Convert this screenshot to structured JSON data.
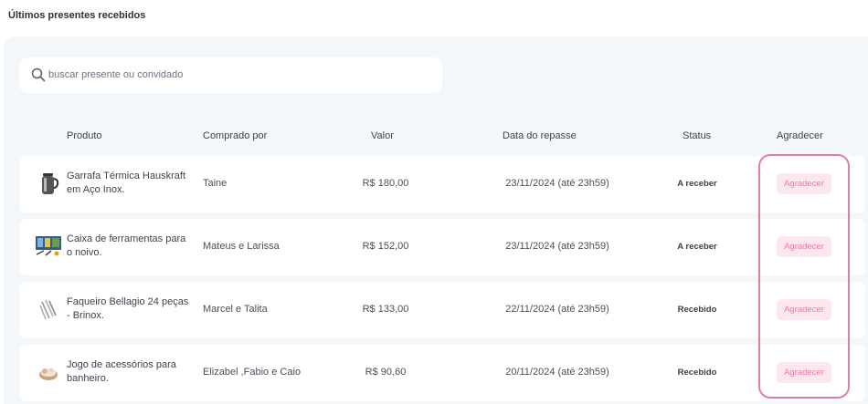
{
  "section": {
    "title": "Últimos presentes recebidos"
  },
  "search": {
    "placeholder": "buscar presente ou convidado",
    "value": ""
  },
  "table": {
    "headers": [
      "Produto",
      "Comprado por",
      "Valor",
      "Data do repasse",
      "Status",
      "Agradecer"
    ],
    "rows": [
      {
        "product": "Garrafa Térmica Hauskraft em Aço Inox.",
        "buyer": "Taine",
        "value": "R$ 180,00",
        "date": "23/11/2024 (até 23h59)",
        "status": "A receber",
        "action": "Agradecer",
        "icon": "thermos-icon"
      },
      {
        "product": "Caixa de ferramentas para o noivo.",
        "buyer": "Mateus e Larissa",
        "value": "R$ 152,00",
        "date": "23/11/2024 (até 23h59)",
        "status": "A receber",
        "action": "Agradecer",
        "icon": "toolbox-icon"
      },
      {
        "product": "Faqueiro Bellagio 24 peças - Brinox.",
        "buyer": "Marcel e Talita",
        "value": "R$ 133,00",
        "date": "22/11/2024 (até 23h59)",
        "status": "Recebido",
        "action": "Agradecer",
        "icon": "cutlery-icon"
      },
      {
        "product": "Jogo de acessórios para banheiro.",
        "buyer": "Elizabel ,Fabio e Caio",
        "value": "R$ 90,60",
        "date": "20/11/2024 (até 23h59)",
        "status": "Recebido",
        "action": "Agradecer",
        "icon": "bath-accessories-icon"
      }
    ]
  },
  "colors": {
    "panel": "#f4f7fa",
    "accent_pink": "#df7ea3",
    "button_bg": "#fde7ee",
    "button_text": "#ee7ba0"
  }
}
